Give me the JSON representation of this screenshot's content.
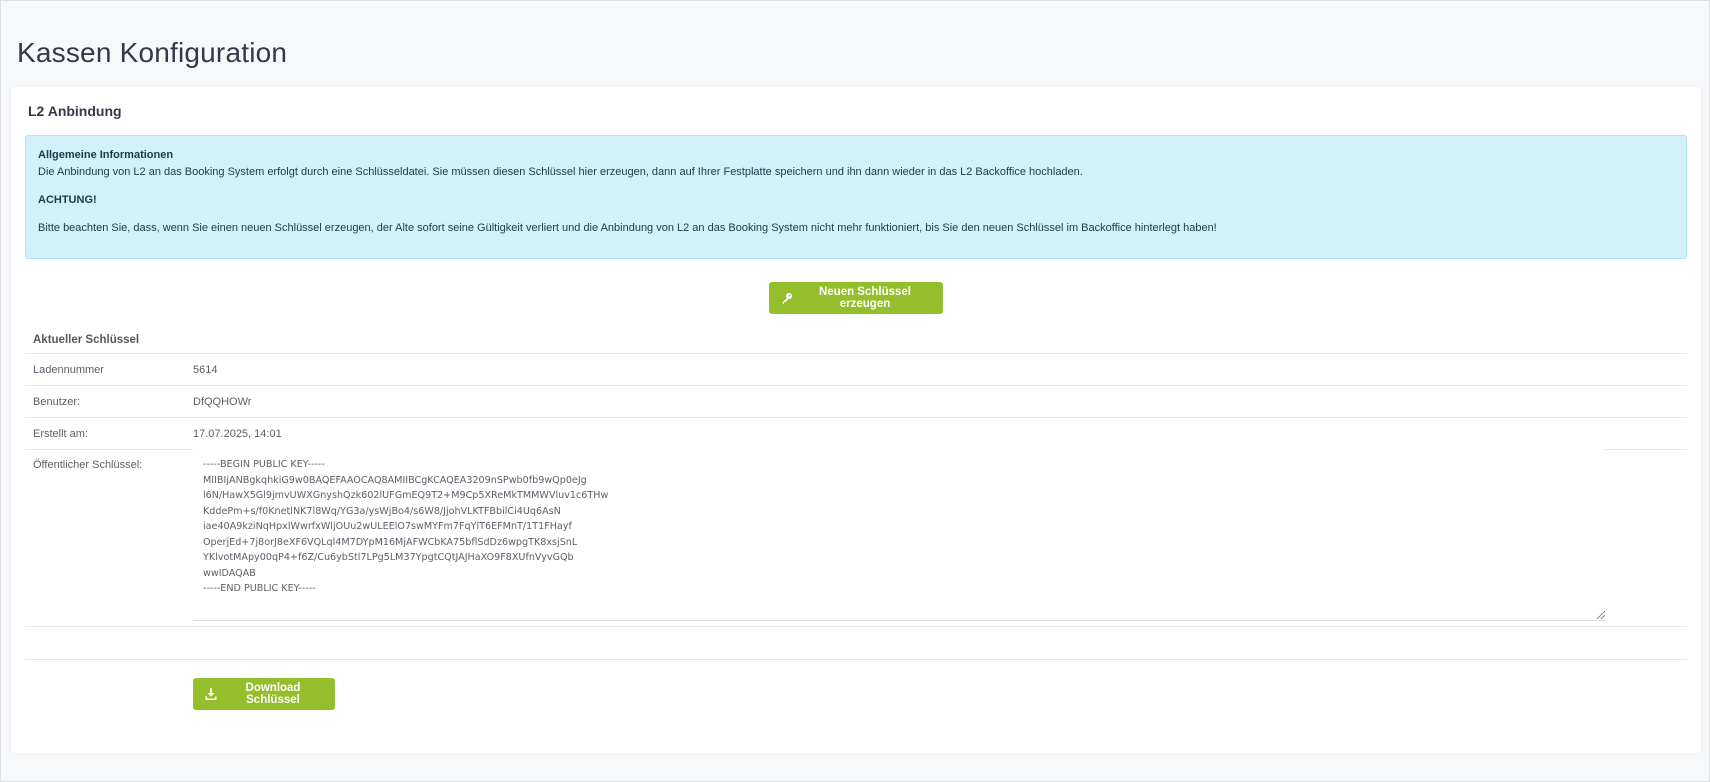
{
  "page": {
    "title": "Kassen Konfiguration"
  },
  "card": {
    "title": "L2 Anbindung"
  },
  "alert": {
    "title": "Allgemeine Informationen",
    "line1": "Die Anbindung von L2 an das Booking System erfolgt durch eine Schlüsseldatei. Sie müssen diesen Schlüssel hier erzeugen, dann auf Ihrer Festplatte speichern und ihn dann wieder in das L2 Backoffice hochladen.",
    "warning": "ACHTUNG!",
    "line2": "Bitte beachten Sie, dass, wenn Sie einen neuen Schlüssel erzeugen, der Alte sofort seine Gültigkeit verliert und die Anbindung von L2 an das Booking System nicht mehr funktioniert, bis Sie den neuen Schlüssel im Backoffice hinterlegt haben!"
  },
  "buttons": {
    "new_key": "Neuen Schlüssel erzeugen",
    "download": "Download Schlüssel",
    "new_key_icon": "key-icon",
    "download_icon": "download-icon"
  },
  "key_table": {
    "header": "Aktueller Schlüssel",
    "rows": [
      {
        "label": "Ladennummer",
        "value": "5614"
      },
      {
        "label": "Benutzer:",
        "value": "DfQQHOWr"
      },
      {
        "label": "Erstellt am:",
        "value": "17.07.2025, 14:01"
      },
      {
        "label": "Öffentlicher Schlüssel:"
      }
    ],
    "public_key": "-----BEGIN PUBLIC KEY-----\nMIIBIjANBgkqhkiG9w0BAQEFAAOCAQ8AMIIBCgKCAQEA3209nSPwb0fb9wQp0eJg\nl6N/HawX5Gl9jmvUWXGnyshQzk602lUFGmEQ9T2+M9Cp5XReMkTMMWVluv1c6THw\nKddePm+s/f0KnetlNK7l8Wq/YG3a/ysWjBo4/s6W8/JjohVLKTFBbilCi4Uq6AsN\niae40A9kziNqHpxlWwrfxWljOUu2wULEElO7swMYFm7FqYlT6EFMnT/1T1FHayf\nOperjEd+7j8orJ8eXF6VQLql4M7DYpM16MjAFWCbKA75bflSdDz6wpgTK8xsjSnL\nYKlvotMApy00qP4+f6Z/Cu6ybStl7LPg5LM37YpgtCQtJAJHaXO9F8XUfnVyvGQb\nwwIDAQAB\n-----END PUBLIC KEY-----"
  },
  "colors": {
    "accent_green": "#95be2c",
    "alert_bg": "#d2f1fb",
    "title_text": "#313a46"
  }
}
